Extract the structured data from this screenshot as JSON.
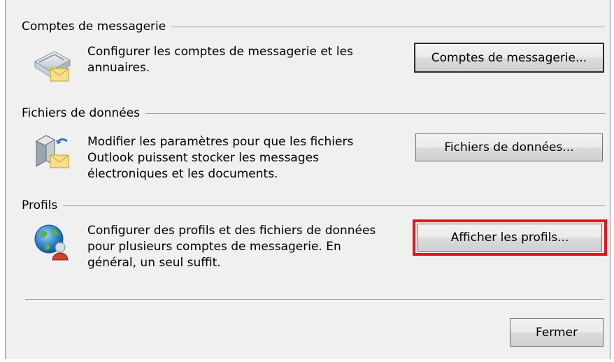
{
  "sections": {
    "accounts": {
      "title": "Comptes de messagerie",
      "line1": "Configurer les comptes de messagerie et les",
      "line2": "annuaires.",
      "button": "Comptes de messagerie...",
      "icon": "email-accounts-icon"
    },
    "datafiles": {
      "title": "Fichiers de données",
      "line1": "Modifier les paramètres pour que les fichiers",
      "line2": "Outlook puissent stocker les messages",
      "line3": "électroniques et les documents.",
      "button": "Fichiers de données...",
      "icon": "data-files-icon"
    },
    "profiles": {
      "title": "Profils",
      "line1": "Configurer des profils et des fichiers de données",
      "line2": "pour plusieurs comptes de messagerie. En",
      "line3": "général, un seul suffit.",
      "button": "Afficher les profils...",
      "icon": "profiles-globe-icon"
    }
  },
  "footer": {
    "close_button": "Fermer"
  },
  "colors": {
    "highlight": "#e8141c",
    "panel": "#f0f0f0"
  }
}
